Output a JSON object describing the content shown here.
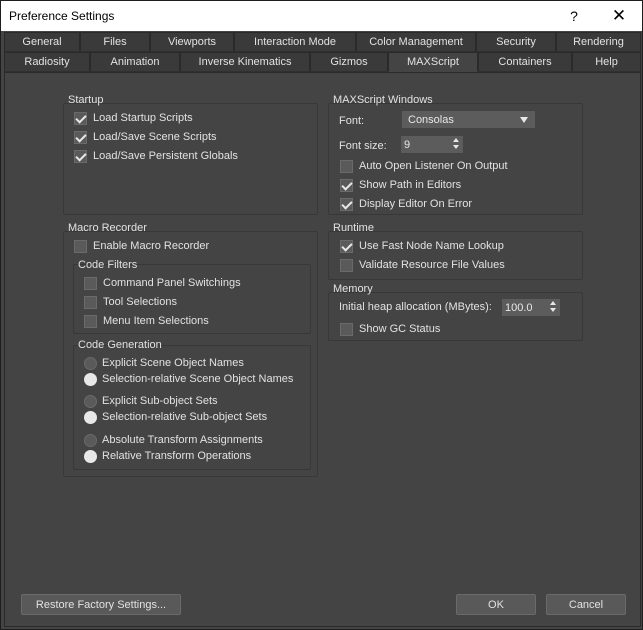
{
  "window": {
    "title": "Preference Settings",
    "help_glyph": "?",
    "close_glyph": "✕"
  },
  "tabs_row1": [
    "General",
    "Files",
    "Viewports",
    "Interaction Mode",
    "Color Management",
    "Security",
    "Rendering"
  ],
  "tabs_row2": [
    "Radiosity",
    "Animation",
    "Inverse Kinematics",
    "Gizmos",
    "MAXScript",
    "Containers",
    "Help"
  ],
  "active_tab": "MAXScript",
  "startup": {
    "title": "Startup",
    "items": [
      {
        "label": "Load Startup Scripts",
        "checked": true
      },
      {
        "label": "Load/Save Scene Scripts",
        "checked": true
      },
      {
        "label": "Load/Save Persistent Globals",
        "checked": true
      }
    ]
  },
  "macro_recorder": {
    "title": "Macro Recorder",
    "enable": {
      "label": "Enable Macro Recorder",
      "checked": false
    },
    "code_filters": {
      "title": "Code Filters",
      "items": [
        {
          "label": "Command Panel Switchings",
          "checked": false
        },
        {
          "label": "Tool Selections",
          "checked": false
        },
        {
          "label": "Menu Item Selections",
          "checked": false
        }
      ]
    },
    "code_generation": {
      "title": "Code Generation",
      "items": [
        {
          "label": "Explicit Scene Object Names",
          "checked": false
        },
        {
          "label": "Selection-relative Scene Object Names",
          "checked": true
        },
        {
          "label": "Explicit Sub-object Sets",
          "checked": false
        },
        {
          "label": "Selection-relative Sub-object Sets",
          "checked": true
        },
        {
          "label": "Absolute Transform Assignments",
          "checked": false
        },
        {
          "label": "Relative Transform Operations",
          "checked": true
        }
      ]
    }
  },
  "maxscript_windows": {
    "title": "MAXScript Windows",
    "font_label": "Font:",
    "font_value": "Consolas",
    "font_size_label": "Font size:",
    "font_size_value": "9",
    "items": [
      {
        "label": "Auto Open Listener On Output",
        "checked": false
      },
      {
        "label": "Show Path in Editors",
        "checked": true
      },
      {
        "label": "Display Editor On Error",
        "checked": true
      }
    ]
  },
  "runtime": {
    "title": "Runtime",
    "items": [
      {
        "label": "Use Fast Node Name Lookup",
        "checked": true
      },
      {
        "label": "Validate Resource File Values",
        "checked": false
      }
    ]
  },
  "memory": {
    "title": "Memory",
    "heap_label": "Initial heap allocation (MBytes):",
    "heap_value": "100.0",
    "gc": {
      "label": "Show GC Status",
      "checked": false
    }
  },
  "buttons": {
    "restore": "Restore Factory Settings...",
    "ok": "OK",
    "cancel": "Cancel"
  }
}
